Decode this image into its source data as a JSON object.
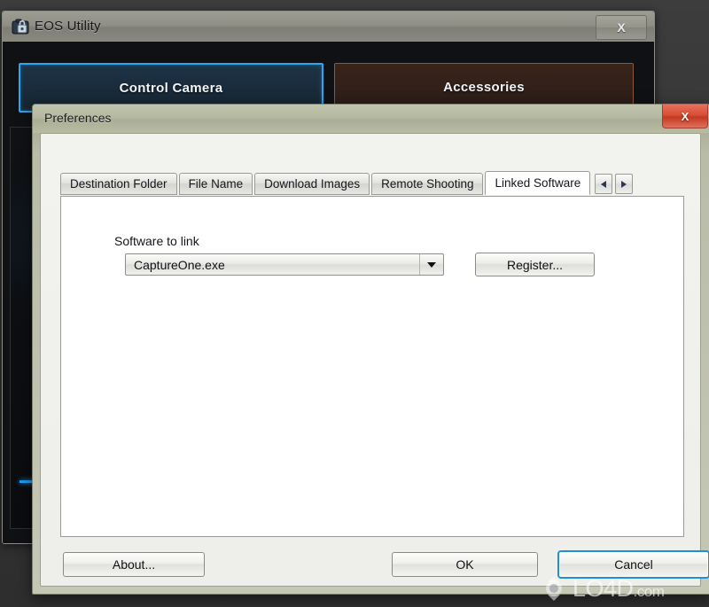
{
  "eos_window": {
    "title": "EOS Utility",
    "icon": "camera-lock-icon",
    "close_label": "X",
    "modes": [
      {
        "label": "Control Camera",
        "state": "selected",
        "accent": "#27a8f0"
      },
      {
        "label": "Accessories",
        "state": "normal",
        "accent": "#8a5a40"
      }
    ]
  },
  "prefs_dialog": {
    "title": "Preferences",
    "close_label": "X",
    "close_color": "#d84e36",
    "tabs": [
      {
        "label": "Destination Folder",
        "selected": false
      },
      {
        "label": "File Name",
        "selected": false
      },
      {
        "label": "Download Images",
        "selected": false
      },
      {
        "label": "Remote Shooting",
        "selected": false
      },
      {
        "label": "Linked Software",
        "selected": true
      }
    ],
    "tab_nav": {
      "prev_icon": "chevron-left-icon",
      "next_icon": "chevron-right-icon"
    },
    "linked_software": {
      "section_label": "Software to link",
      "combo": {
        "value": "CaptureOne.exe",
        "arrow_icon": "chevron-down-icon"
      },
      "register_label": "Register..."
    },
    "buttons": {
      "about": "About...",
      "ok": "OK",
      "cancel": "Cancel",
      "focused": "Cancel",
      "focus_color": "#1f8fd8"
    }
  },
  "watermark": {
    "text": "LO4D",
    "suffix": ".com",
    "icon": "lo4d-recycle-icon"
  }
}
